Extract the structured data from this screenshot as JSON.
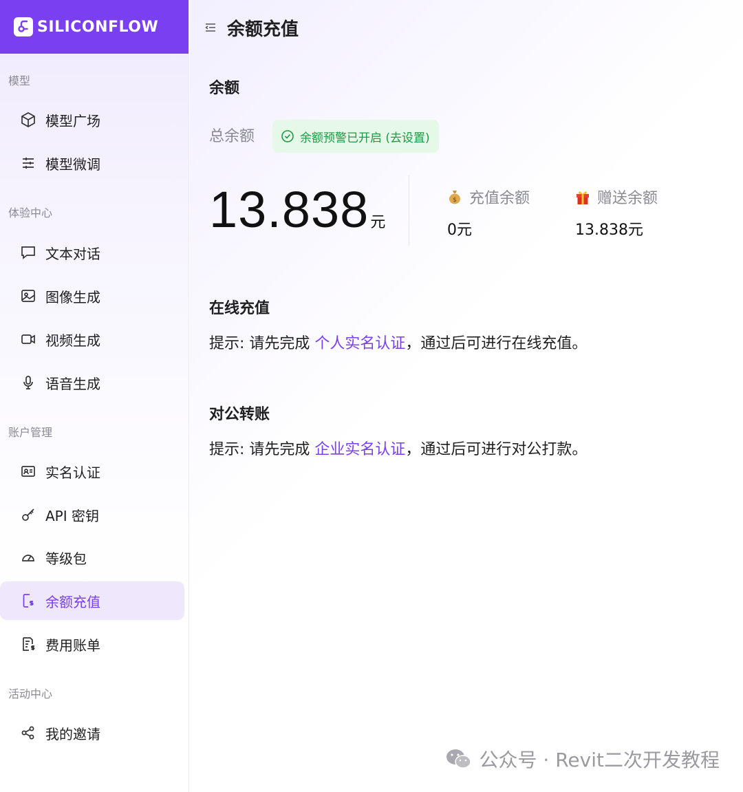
{
  "brand": {
    "name": "SILICONFLOW",
    "color": "#7b3ff2"
  },
  "sidebar": {
    "sections": [
      {
        "title": "模型"
      },
      {
        "title": "体验中心"
      },
      {
        "title": "账户管理"
      },
      {
        "title": "活动中心"
      }
    ],
    "items": [
      {
        "label": "模型广场",
        "icon": "cube-icon"
      },
      {
        "label": "模型微调",
        "icon": "sliders-icon"
      },
      {
        "label": "文本对话",
        "icon": "chat-icon"
      },
      {
        "label": "图像生成",
        "icon": "image-icon"
      },
      {
        "label": "视频生成",
        "icon": "video-icon"
      },
      {
        "label": "语音生成",
        "icon": "mic-icon"
      },
      {
        "label": "实名认证",
        "icon": "id-card-icon"
      },
      {
        "label": "API 密钥",
        "icon": "key-icon"
      },
      {
        "label": "等级包",
        "icon": "gauge-icon"
      },
      {
        "label": "余额充值",
        "icon": "phone-dollar-icon",
        "active": true
      },
      {
        "label": "费用账单",
        "icon": "bill-icon"
      },
      {
        "label": "我的邀请",
        "icon": "share-icon"
      }
    ]
  },
  "header": {
    "title": "余额充值"
  },
  "balance": {
    "heading": "余额",
    "total_label": "总余额",
    "alert_text": "余额预警已开启 (去设置)",
    "total_value": "13.838",
    "unit": "元",
    "recharge_label": "充值余额",
    "recharge_value": "0元",
    "gift_label": "赠送余额",
    "gift_value": "13.838元"
  },
  "online": {
    "heading": "在线充值",
    "hint_prefix": "提示: 请先完成 ",
    "link": "个人实名认证",
    "hint_suffix": "，通过后可进行在线充值。"
  },
  "corporate": {
    "heading": "对公转账",
    "hint_prefix": "提示: 请先完成 ",
    "link": "企业实名认证",
    "hint_suffix": "，通过后可进行对公打款。"
  },
  "watermark": {
    "text": "公众号 · Revit二次开发教程"
  }
}
